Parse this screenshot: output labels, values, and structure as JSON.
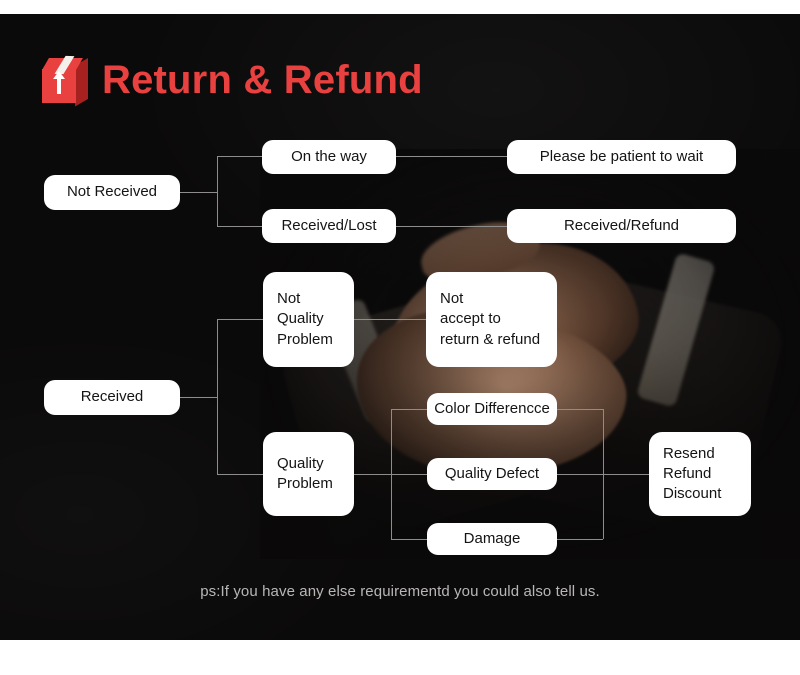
{
  "header": {
    "title": "Return & Refund",
    "icon": "package-box-icon",
    "accent_color": "#e8413f"
  },
  "theme": {
    "stage_background": "#0b0a0a",
    "node_background": "#ffffff",
    "node_text_color": "#141414",
    "connector_color": "#8f8d8b",
    "footnote_color": "#b9b7b5"
  },
  "flow": {
    "nodes": {
      "not_received": "Not Received",
      "on_the_way": "On the way",
      "received_lost": "Received/Lost",
      "please_wait": "Please be patient to wait",
      "received_refund": "Received/Refund",
      "received": "Received",
      "not_quality_problem": "Not\nQuality\nProblem",
      "not_accept": "Not\naccept to\nreturn & refund",
      "quality_problem": "Quality\nProblem",
      "color_difference": "Color Differencce",
      "quality_defect": "Quality Defect",
      "damage": "Damage",
      "resolution": "Resend\nRefund\nDiscount"
    }
  },
  "footnote": {
    "text": "ps:If you have any else requirementd you could also tell us."
  }
}
